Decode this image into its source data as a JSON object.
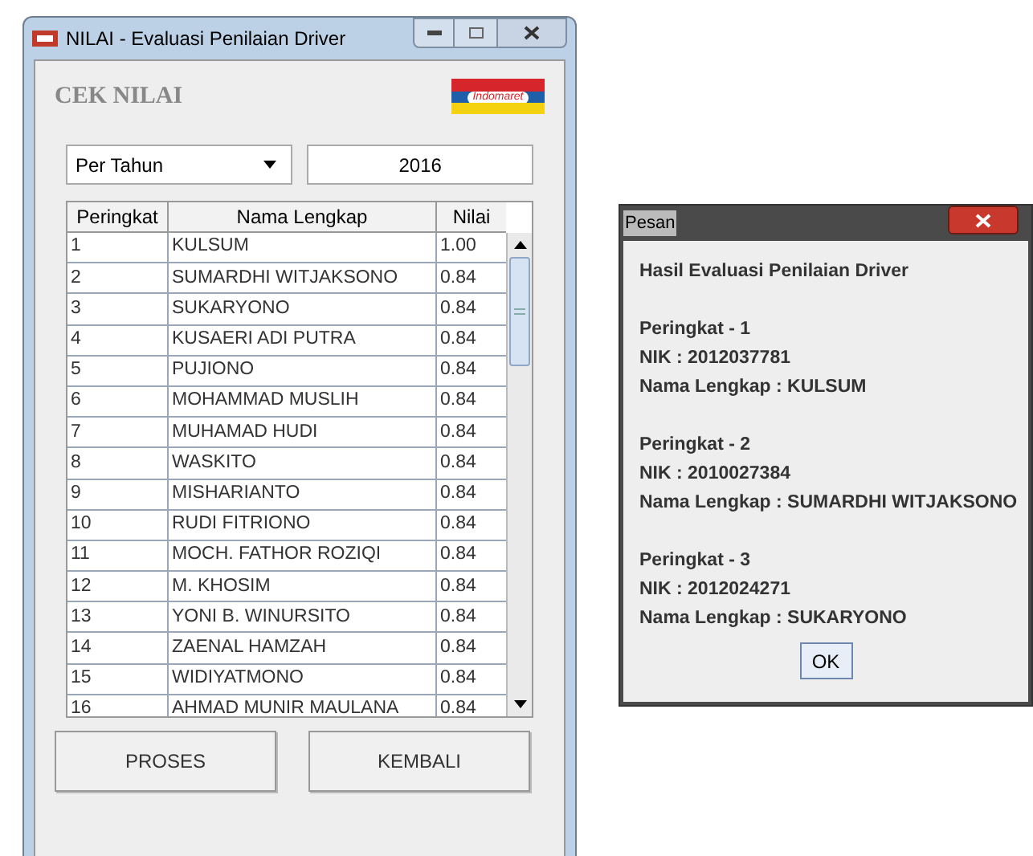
{
  "main_window": {
    "title": "NILAI - Evaluasi Penilaian Driver",
    "heading": "CEK NILAI",
    "logo_text": "Indomaret",
    "period_select": {
      "value": "Per Tahun"
    },
    "year_field": {
      "value": "2016"
    },
    "table": {
      "columns": [
        "Peringkat",
        "Nama Lengkap",
        "Nilai"
      ],
      "rows": [
        [
          "1",
          "KULSUM",
          "1.00"
        ],
        [
          "2",
          "SUMARDHI WITJAKSONO",
          "0.84"
        ],
        [
          "3",
          "SUKARYONO",
          "0.84"
        ],
        [
          "4",
          "KUSAERI ADI PUTRA",
          "0.84"
        ],
        [
          "5",
          "PUJIONO",
          "0.84"
        ],
        [
          "6",
          "MOHAMMAD MUSLIH",
          "0.84"
        ],
        [
          "7",
          "MUHAMAD HUDI",
          "0.84"
        ],
        [
          "8",
          "WASKITO",
          "0.84"
        ],
        [
          "9",
          "MISHARIANTO",
          "0.84"
        ],
        [
          "10",
          "RUDI FITRIONO",
          "0.84"
        ],
        [
          "11",
          "MOCH. FATHOR ROZIQI",
          "0.84"
        ],
        [
          "12",
          "M. KHOSIM",
          "0.84"
        ],
        [
          "13",
          "YONI B. WINURSITO",
          "0.84"
        ],
        [
          "14",
          "ZAENAL HAMZAH",
          "0.84"
        ],
        [
          "15",
          "WIDIYATMONO",
          "0.84"
        ],
        [
          "16",
          "AHMAD MUNIR MAULANA",
          "0.84"
        ]
      ]
    },
    "buttons": [
      "PROSES",
      "KEMBALI"
    ]
  },
  "dialog": {
    "title": "Pesan",
    "heading": "Hasil Evaluasi Penilaian Driver",
    "results": [
      {
        "rank": "Peringkat - 1",
        "nik": "NIK : 2012037781",
        "name": "Nama Lengkap : KULSUM"
      },
      {
        "rank": "Peringkat - 2",
        "nik": "NIK : 2010027384",
        "name": "Nama Lengkap : SUMARDHI WITJAKSONO"
      },
      {
        "rank": "Peringkat - 3",
        "nik": "NIK : 2012024271",
        "name": "Nama Lengkap : SUKARYONO"
      }
    ],
    "button": "OK"
  }
}
